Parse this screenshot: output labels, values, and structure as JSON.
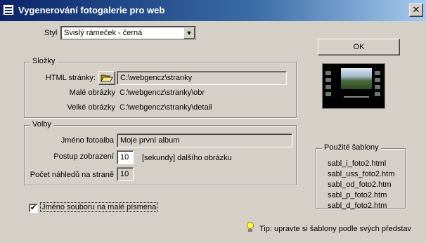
{
  "window": {
    "title": "Vygenerování fotogalerie pro web",
    "close_glyph": "✕"
  },
  "style": {
    "label": "Styl",
    "selected": "Svislý rámeček - černá",
    "drop_glyph": "▼"
  },
  "ok_button": "OK",
  "folders": {
    "legend": "Složky",
    "html_label": "HTML stránky:",
    "html_path": "C:\\webgencz\\stranky",
    "small_label": "Malé obrázky",
    "small_path": "C:\\webgencz\\stranky\\obr",
    "large_label": "Velké obrázky",
    "large_path": "C:\\webgencz\\stranky\\detail",
    "folder_icon": "folder-open-icon"
  },
  "options": {
    "legend": "Volby",
    "album_name_label": "Jméno fotoalba",
    "album_name_value": "Moje první album",
    "interval_label": "Postup zobrazení",
    "interval_value": "10",
    "interval_suffix": "[sekundy] dalšího obrázku",
    "thumbs_label": "Počet náhledů na straně",
    "thumbs_value": "10"
  },
  "lowercase_checkbox": {
    "label": "Jméno souboru na malé písmena",
    "checked": true,
    "check_glyph": "✔"
  },
  "templates": {
    "legend": "Použité šablony",
    "items": [
      "sabl_i_foto2.html",
      "sabl_uss_foto2.htm",
      "sabl_od_foto2.htm",
      "sabl_p_foto2.htm",
      "sabl_d_foto2.htm"
    ]
  },
  "tip": {
    "text": "Tip: upravte si šablony podle svých představ",
    "icon": "lightbulb-icon"
  },
  "colors": {
    "face": "#d4d0c8",
    "title_start": "#0a246a",
    "title_end": "#a6caf0"
  }
}
